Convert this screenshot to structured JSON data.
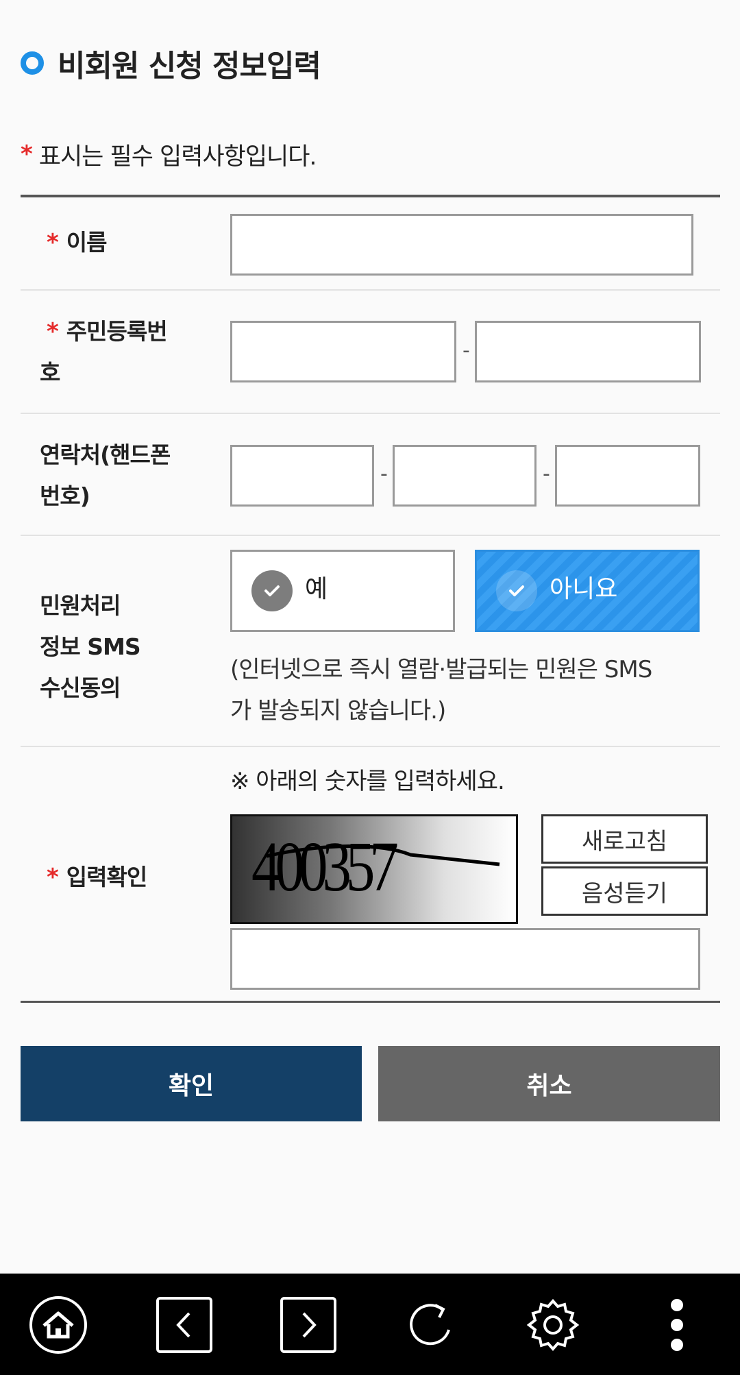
{
  "header": {
    "title": "비회원 신청 정보입력"
  },
  "required_note": {
    "star": "*",
    "text": "표시는 필수 입력사항입니다."
  },
  "form": {
    "name": {
      "star": "*",
      "label": "이름",
      "value": ""
    },
    "rrn": {
      "star": "*",
      "label_line1": "주민등록번",
      "label_line2": "호",
      "part1": "",
      "part2": "",
      "separator": "-"
    },
    "phone": {
      "label_line1": "연락처(핸드폰",
      "label_line2": "번호)",
      "part1": "",
      "part2": "",
      "part3": "",
      "separator": "-"
    },
    "sms": {
      "label_line1": "민원처리",
      "label_line2": "정보 SMS",
      "label_line3": "수신동의",
      "option_yes": "예",
      "option_no": "아니요",
      "selected": "아니요",
      "note_line1": "(인터넷으로 즉시 열람·발급되는 민원은 SMS",
      "note_line2": "가 발송되지 않습니다.)"
    },
    "captcha": {
      "star": "*",
      "label": "입력확인",
      "hint": "※ 아래의 숫자를 입력하세요.",
      "image_text": "400357",
      "refresh_label": "새로고침",
      "audio_label": "음성듣기",
      "value": ""
    }
  },
  "actions": {
    "ok_label": "확인",
    "cancel_label": "취소"
  },
  "colors": {
    "accent": "#1e90e6",
    "required": "#e52b2b",
    "ok_button": "#144067",
    "cancel_button": "#666666",
    "selected_option": "#2c94ea"
  },
  "navbar": {
    "icons": [
      "home-icon",
      "back-icon",
      "forward-icon",
      "refresh-icon",
      "settings-icon",
      "more-icon"
    ]
  }
}
